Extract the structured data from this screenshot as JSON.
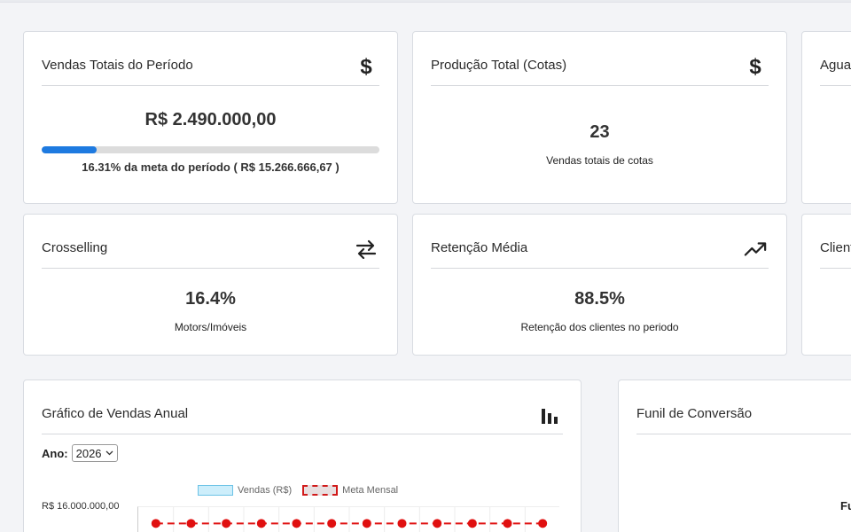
{
  "cards": {
    "vendas": {
      "title": "Vendas Totais do Período",
      "value": "R$ 2.490.000,00",
      "progress_pct": 16.31,
      "subtitle": "16.31% da meta do período ( R$ 15.266.666,67 )",
      "icon": "dollar-icon"
    },
    "producao": {
      "title": "Produção Total (Cotas)",
      "value": "23",
      "subtitle": "Vendas totais de cotas",
      "icon": "dollar-icon"
    },
    "aguardando": {
      "title": "Agua"
    },
    "crosselling": {
      "title": "Crosselling",
      "value": "16.4%",
      "subtitle": "Motors/Imóveis",
      "icon": "swap-arrows-icon"
    },
    "retencao": {
      "title": "Retenção Média",
      "value": "88.5%",
      "subtitle": "Retenção dos clientes no periodo",
      "icon": "trending-up-icon"
    },
    "clientes": {
      "title": "Client"
    }
  },
  "sales_chart": {
    "title": "Gráfico de Vendas Anual",
    "icon": "bar-chart-icon",
    "year_label": "Ano:",
    "year_value": "2026",
    "legend_sales": "Vendas (R$)",
    "legend_goal": "Meta Mensal",
    "y_tick_top": "R$ 16.000.000,00",
    "colors": {
      "sales_fill": "#cdeefb",
      "sales_stroke": "#6cc3e6",
      "goal": "#e01010"
    }
  },
  "funnel": {
    "title": "Funil de Conversão",
    "partial_label": "Fu"
  },
  "colors": {
    "accent": "#1e7ae0",
    "progress_track": "#dcdcdc"
  },
  "chart_data": {
    "type": "line",
    "categories": [
      "",
      "",
      "",
      "",
      "",
      "",
      "",
      "",
      "",
      "",
      "",
      ""
    ],
    "series": [
      {
        "name": "Meta Mensal",
        "values": [
          15266666.67,
          15266666.67,
          15266666.67,
          15266666.67,
          15266666.67,
          15266666.67,
          15266666.67,
          15266666.67,
          15266666.67,
          15266666.67,
          15266666.67,
          15266666.67
        ]
      }
    ],
    "ylim": [
      0,
      16000000
    ],
    "y_tick_labels": [
      "R$ 16.000.000,00"
    ],
    "legend": [
      "Vendas (R$)",
      "Meta Mensal"
    ],
    "legend_placement": "top"
  }
}
